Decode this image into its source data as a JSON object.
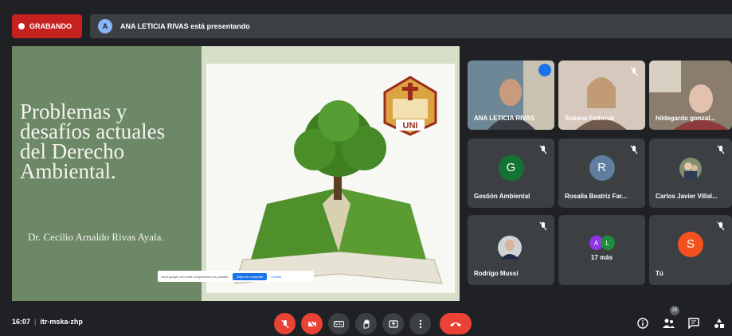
{
  "recording": {
    "label": "GRABANDO"
  },
  "presenter_bar": {
    "avatar_letter": "A",
    "text": "ANA LETICIA RIVAS está presentando"
  },
  "slide": {
    "title": "Problemas y\ndesafíos actuales\ndel Derecho\nAmbiental.",
    "author": "Dr. Cecilio Arnaldo Rivas Ayala.",
    "logo_text": "UNI",
    "share_notice": {
      "text": "meet.google.com está compartiendo tu pantalla.",
      "stop_label": "Dejar de compartir",
      "hide_label": "Ocultar"
    }
  },
  "participants": [
    {
      "name": "ANA LETICIA RIVAS",
      "type": "photo",
      "speaking": true
    },
    {
      "name": "Susana Fedoruk",
      "type": "photo",
      "muted": true
    },
    {
      "name": "hildegardo gonzal...",
      "type": "photo"
    },
    {
      "name": "Gestión Ambiental",
      "type": "avatar",
      "letter": "G",
      "color": "#137333",
      "muted": true
    },
    {
      "name": "Rosalia Beatriz Far...",
      "type": "avatar",
      "letter": "R",
      "color": "#5f7ea0",
      "muted": true
    },
    {
      "name": "Carlos Javier Villal...",
      "type": "photo-small",
      "muted": true
    },
    {
      "name": "Rodrigo Mussi",
      "type": "photo-small",
      "muted": true
    },
    {
      "name": "17 más",
      "type": "more",
      "letters": [
        "A",
        "L"
      ]
    },
    {
      "name": "Tú",
      "type": "avatar",
      "letter": "S",
      "color": "#f4511e",
      "muted": true
    }
  ],
  "meeting": {
    "time": "16:07",
    "code": "itr-mska-zhp"
  },
  "controls": {
    "people_count": "26",
    "captions_label": "CC"
  },
  "icons": [
    "record-icon",
    "mic-off-icon",
    "camera-off-icon",
    "captions-icon",
    "raise-hand-icon",
    "present-icon",
    "more-options-icon",
    "end-call-icon",
    "info-icon",
    "people-icon",
    "chat-icon",
    "activities-icon"
  ]
}
